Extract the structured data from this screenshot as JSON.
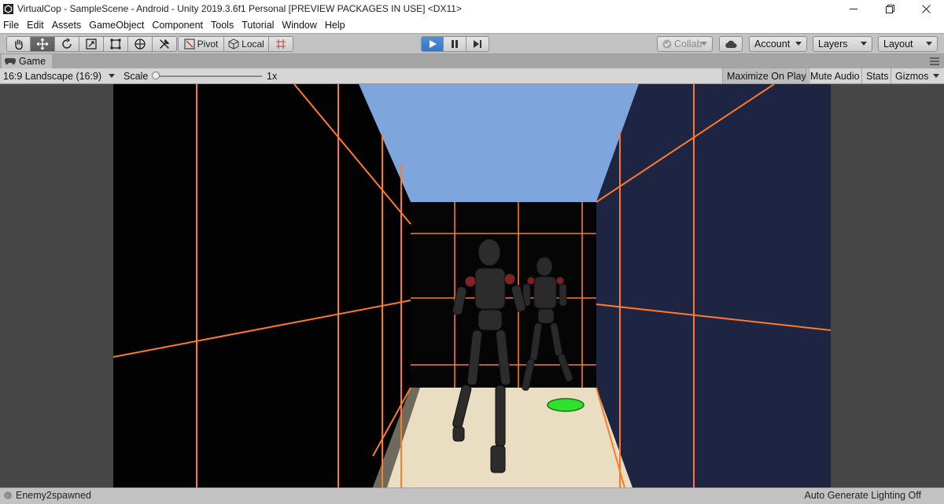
{
  "window": {
    "title": "VirtualCop - SampleScene - Android - Unity 2019.3.6f1 Personal [PREVIEW PACKAGES IN USE] <DX11>",
    "controls": [
      "minimize-icon",
      "restore-icon",
      "close-icon"
    ]
  },
  "menu": [
    "File",
    "Edit",
    "Assets",
    "GameObject",
    "Component",
    "Tools",
    "Tutorial",
    "Window",
    "Help"
  ],
  "toolbar": {
    "transform_tools": [
      "hand-icon",
      "move-icon",
      "rotate-icon",
      "scale-icon",
      "rect-icon",
      "transform-icon",
      "custom-tool-icon"
    ],
    "active_tool": "move-icon",
    "pivot_label": "Pivot",
    "local_label": "Local",
    "snap_icon": "grid-snap-icon",
    "play_state": "playing",
    "collab_label": "Collab",
    "account_label": "Account",
    "layers_label": "Layers",
    "layout_label": "Layout",
    "accent_color": "#3a76bf"
  },
  "game_tab": {
    "label": "Game",
    "icon": "game-controller-icon"
  },
  "game_toolbar": {
    "aspect": "16:9 Landscape (16:9)",
    "scale_label": "Scale",
    "scale_value": "1x",
    "scale_level": 0,
    "maximize_on_play": "Maximize On Play",
    "mute_audio": "Mute Audio",
    "stats": "Stats",
    "gizmos": "Gizmos"
  },
  "scene": {
    "description_colors": {
      "sky": "#7aa3da",
      "grid_lines": "#ff7a2a",
      "right_wall": "#1d2441",
      "floor": "#e8dcc1",
      "target_marker": "#2fe02f"
    },
    "characters": 2
  },
  "status": {
    "message": "Enemy2spawned",
    "lighting": "Auto Generate Lighting Off"
  }
}
